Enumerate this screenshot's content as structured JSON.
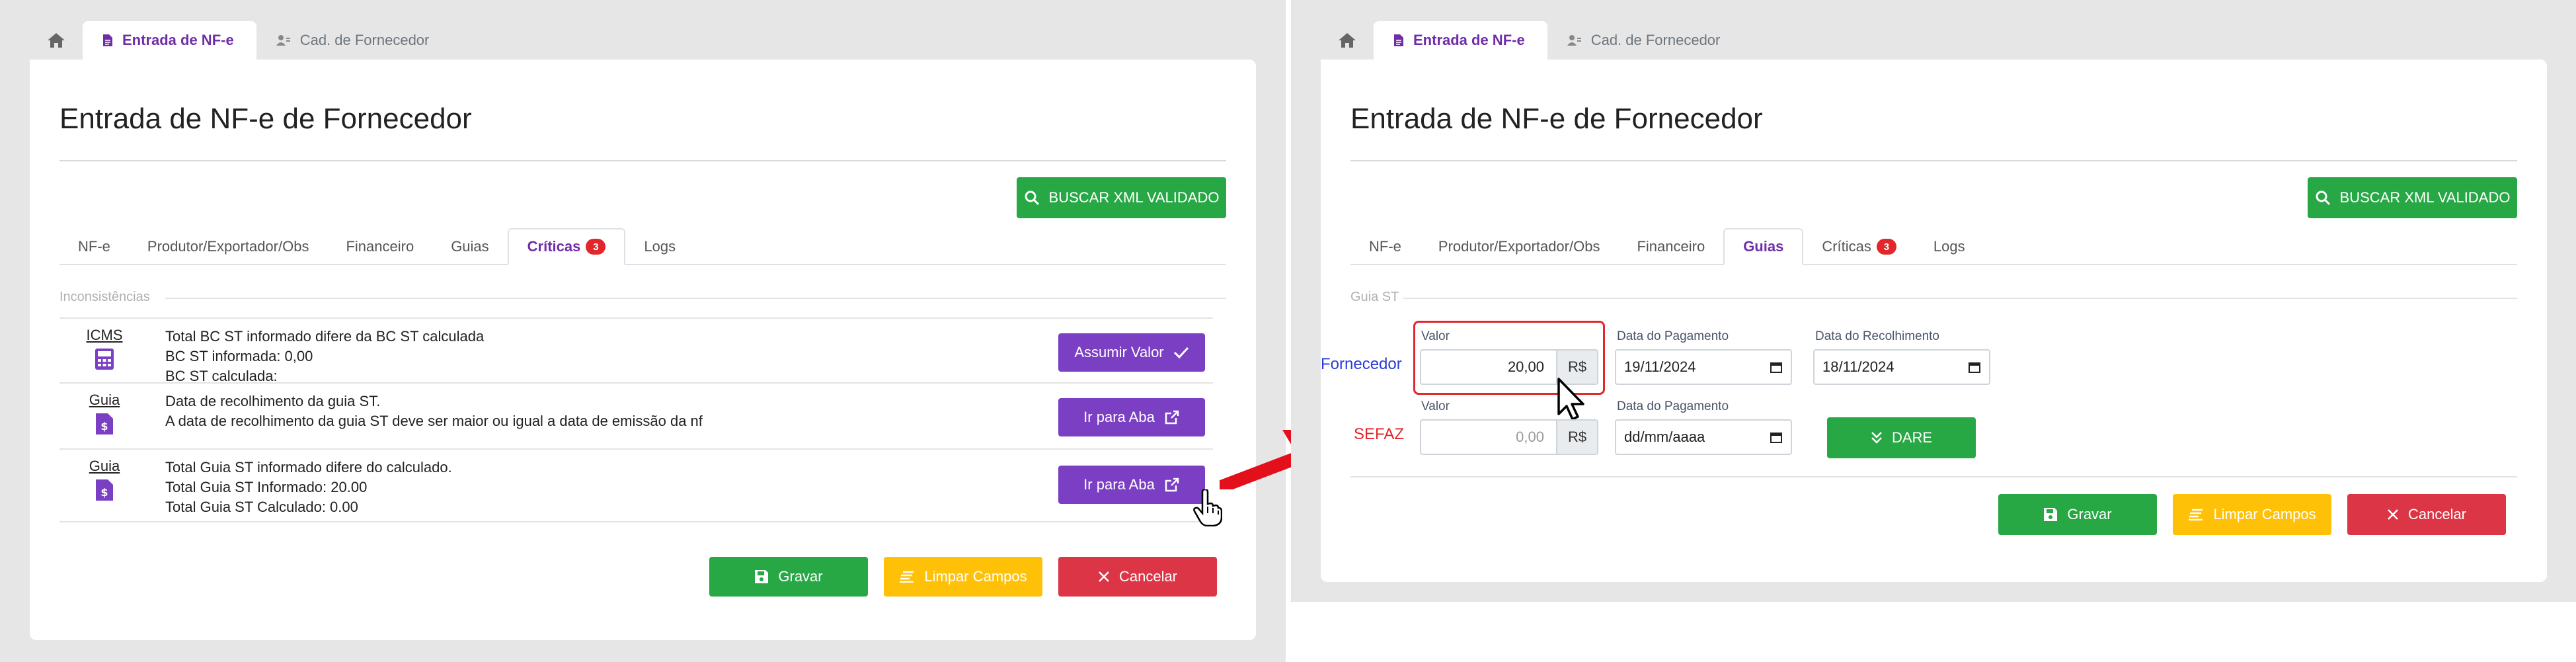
{
  "left": {
    "top_tabs": {
      "tab1": "Entrada de NF-e",
      "tab2": "Cad. de Fornecedor"
    },
    "title": "Entrada de NF-e de Fornecedor",
    "buscar_button": "BUSCAR XML VALIDADO",
    "tabs": {
      "nfe": "NF-e",
      "produtor": "Produtor/Exportador/Obs",
      "financeiro": "Financeiro",
      "guias": "Guias",
      "criticas": "Críticas",
      "criticas_badge": "3",
      "logs": "Logs"
    },
    "section_label": "Inconsistências",
    "criticas": [
      {
        "category": "ICMS",
        "icon": "calculator-icon",
        "line1": "Total BC ST informado difere da BC ST calculada",
        "line2": "BC ST informada: 0,00",
        "line3": "BC ST calculada:",
        "button": "Assumir Valor",
        "button_icon": "check-icon"
      },
      {
        "category": "Guia",
        "icon": "invoice-dollar-icon",
        "line1": "Data de recolhimento da guia ST.",
        "line2": "A data de recolhimento da guia ST deve ser maior ou igual a data de emissão da nf",
        "line3": "",
        "button": "Ir para Aba",
        "button_icon": "external-link-icon"
      },
      {
        "category": "Guia",
        "icon": "invoice-dollar-icon",
        "line1": "Total Guia ST informado difere do calculado.",
        "line2": "Total Guia ST Informado: 20.00",
        "line3": "Total Guia ST Calculado: 0.00",
        "button": "Ir para Aba",
        "button_icon": "external-link-icon"
      }
    ],
    "footer": {
      "save": "Gravar",
      "clear": "Limpar Campos",
      "cancel": "Cancelar"
    }
  },
  "right": {
    "top_tabs": {
      "tab1": "Entrada de NF-e",
      "tab2": "Cad. de Fornecedor"
    },
    "title": "Entrada de NF-e de Fornecedor",
    "buscar_button": "BUSCAR XML VALIDADO",
    "tabs": {
      "nfe": "NF-e",
      "produtor": "Produtor/Exportador/Obs",
      "financeiro": "Financeiro",
      "guias": "Guias",
      "criticas": "Críticas",
      "criticas_badge": "3",
      "logs": "Logs"
    },
    "section_label": "Guia ST",
    "fornecedor": {
      "row_label": "Fornecedor",
      "valor_label": "Valor",
      "valor": "20,00",
      "currency": "R$",
      "pagamento_label": "Data do Pagamento",
      "pagamento": "19/11/2024",
      "recolhimento_label": "Data do Recolhimento",
      "recolhimento": "18/11/2024"
    },
    "sefaz": {
      "row_label": "SEFAZ",
      "valor_label": "Valor",
      "valor_placeholder": "0,00",
      "currency": "R$",
      "pagamento_label": "Data do Pagamento",
      "pagamento_placeholder": "dd/mm/aaaa",
      "dare_button": "DARE"
    },
    "footer": {
      "save": "Gravar",
      "clear": "Limpar Campos",
      "cancel": "Cancelar"
    }
  },
  "colors": {
    "green": "#28a745",
    "purple": "#7b3fc4",
    "yellow": "#ffc107",
    "red": "#dc3545",
    "accent": "#6f2da8",
    "blue_label": "#2b3cd8",
    "red_label": "#e3262b"
  }
}
